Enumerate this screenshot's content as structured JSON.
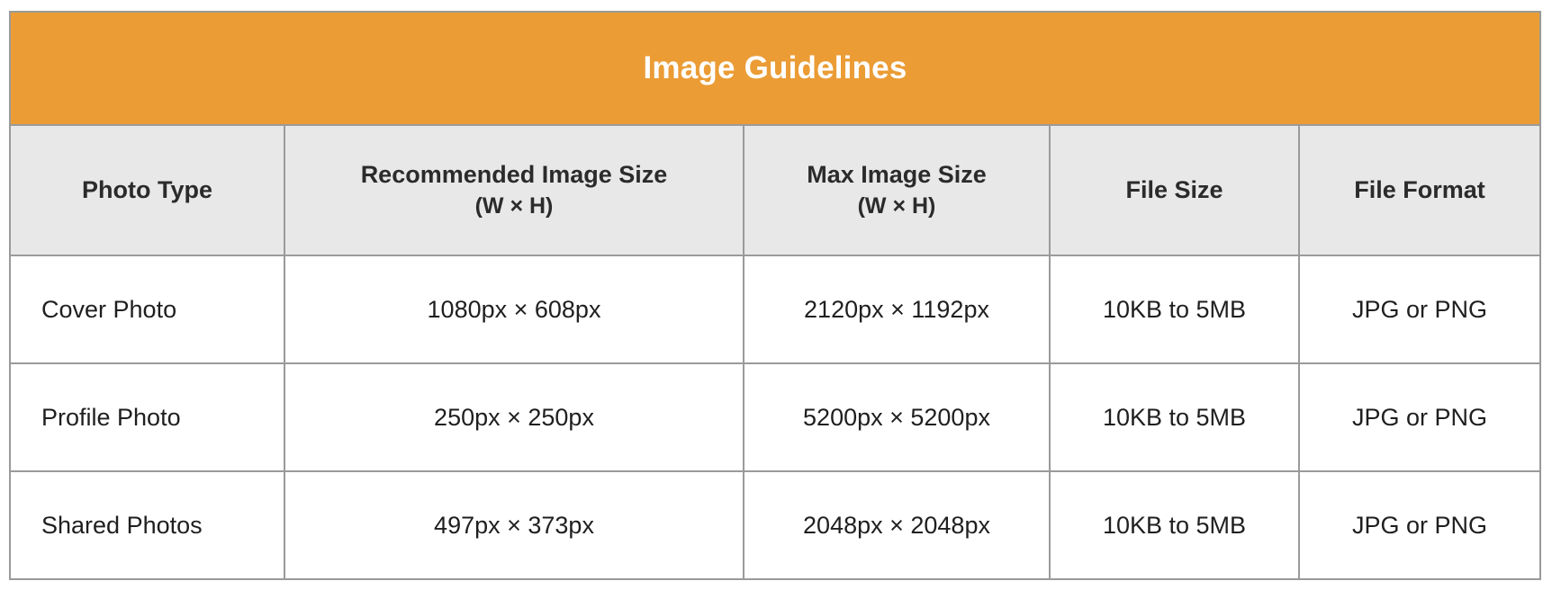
{
  "table": {
    "title": "Image Guidelines",
    "accent_color": "#eb9c35",
    "header_bg_color": "#e8e8e8",
    "border_color": "#9a9a9a",
    "columns": [
      {
        "label": "Photo Type",
        "sub": ""
      },
      {
        "label": "Recommended Image Size",
        "sub": "(W × H)"
      },
      {
        "label": "Max Image Size",
        "sub": "(W × H)"
      },
      {
        "label": "File Size",
        "sub": ""
      },
      {
        "label": "File Format",
        "sub": ""
      }
    ],
    "rows": [
      {
        "photo_type": "Cover Photo",
        "recommended_size": "1080px × 608px",
        "max_size": "2120px × 1192px",
        "file_size": "10KB to 5MB",
        "file_format": "JPG or PNG"
      },
      {
        "photo_type": "Profile Photo",
        "recommended_size": "250px × 250px",
        "max_size": "5200px × 5200px",
        "file_size": "10KB to 5MB",
        "file_format": "JPG or PNG"
      },
      {
        "photo_type": "Shared Photos",
        "recommended_size": "497px × 373px",
        "max_size": "2048px × 2048px",
        "file_size": "10KB to 5MB",
        "file_format": "JPG or PNG"
      }
    ]
  }
}
